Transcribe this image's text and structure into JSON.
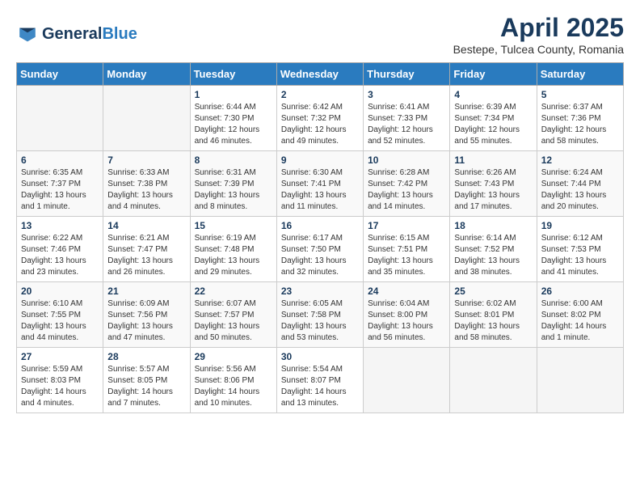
{
  "logo": {
    "general": "General",
    "blue": "Blue"
  },
  "title": "April 2025",
  "subtitle": "Bestepe, Tulcea County, Romania",
  "days_of_week": [
    "Sunday",
    "Monday",
    "Tuesday",
    "Wednesday",
    "Thursday",
    "Friday",
    "Saturday"
  ],
  "weeks": [
    [
      {
        "day": "",
        "info": ""
      },
      {
        "day": "",
        "info": ""
      },
      {
        "day": "1",
        "info": "Sunrise: 6:44 AM\nSunset: 7:30 PM\nDaylight: 12 hours and 46 minutes."
      },
      {
        "day": "2",
        "info": "Sunrise: 6:42 AM\nSunset: 7:32 PM\nDaylight: 12 hours and 49 minutes."
      },
      {
        "day": "3",
        "info": "Sunrise: 6:41 AM\nSunset: 7:33 PM\nDaylight: 12 hours and 52 minutes."
      },
      {
        "day": "4",
        "info": "Sunrise: 6:39 AM\nSunset: 7:34 PM\nDaylight: 12 hours and 55 minutes."
      },
      {
        "day": "5",
        "info": "Sunrise: 6:37 AM\nSunset: 7:36 PM\nDaylight: 12 hours and 58 minutes."
      }
    ],
    [
      {
        "day": "6",
        "info": "Sunrise: 6:35 AM\nSunset: 7:37 PM\nDaylight: 13 hours and 1 minute."
      },
      {
        "day": "7",
        "info": "Sunrise: 6:33 AM\nSunset: 7:38 PM\nDaylight: 13 hours and 4 minutes."
      },
      {
        "day": "8",
        "info": "Sunrise: 6:31 AM\nSunset: 7:39 PM\nDaylight: 13 hours and 8 minutes."
      },
      {
        "day": "9",
        "info": "Sunrise: 6:30 AM\nSunset: 7:41 PM\nDaylight: 13 hours and 11 minutes."
      },
      {
        "day": "10",
        "info": "Sunrise: 6:28 AM\nSunset: 7:42 PM\nDaylight: 13 hours and 14 minutes."
      },
      {
        "day": "11",
        "info": "Sunrise: 6:26 AM\nSunset: 7:43 PM\nDaylight: 13 hours and 17 minutes."
      },
      {
        "day": "12",
        "info": "Sunrise: 6:24 AM\nSunset: 7:44 PM\nDaylight: 13 hours and 20 minutes."
      }
    ],
    [
      {
        "day": "13",
        "info": "Sunrise: 6:22 AM\nSunset: 7:46 PM\nDaylight: 13 hours and 23 minutes."
      },
      {
        "day": "14",
        "info": "Sunrise: 6:21 AM\nSunset: 7:47 PM\nDaylight: 13 hours and 26 minutes."
      },
      {
        "day": "15",
        "info": "Sunrise: 6:19 AM\nSunset: 7:48 PM\nDaylight: 13 hours and 29 minutes."
      },
      {
        "day": "16",
        "info": "Sunrise: 6:17 AM\nSunset: 7:50 PM\nDaylight: 13 hours and 32 minutes."
      },
      {
        "day": "17",
        "info": "Sunrise: 6:15 AM\nSunset: 7:51 PM\nDaylight: 13 hours and 35 minutes."
      },
      {
        "day": "18",
        "info": "Sunrise: 6:14 AM\nSunset: 7:52 PM\nDaylight: 13 hours and 38 minutes."
      },
      {
        "day": "19",
        "info": "Sunrise: 6:12 AM\nSunset: 7:53 PM\nDaylight: 13 hours and 41 minutes."
      }
    ],
    [
      {
        "day": "20",
        "info": "Sunrise: 6:10 AM\nSunset: 7:55 PM\nDaylight: 13 hours and 44 minutes."
      },
      {
        "day": "21",
        "info": "Sunrise: 6:09 AM\nSunset: 7:56 PM\nDaylight: 13 hours and 47 minutes."
      },
      {
        "day": "22",
        "info": "Sunrise: 6:07 AM\nSunset: 7:57 PM\nDaylight: 13 hours and 50 minutes."
      },
      {
        "day": "23",
        "info": "Sunrise: 6:05 AM\nSunset: 7:58 PM\nDaylight: 13 hours and 53 minutes."
      },
      {
        "day": "24",
        "info": "Sunrise: 6:04 AM\nSunset: 8:00 PM\nDaylight: 13 hours and 56 minutes."
      },
      {
        "day": "25",
        "info": "Sunrise: 6:02 AM\nSunset: 8:01 PM\nDaylight: 13 hours and 58 minutes."
      },
      {
        "day": "26",
        "info": "Sunrise: 6:00 AM\nSunset: 8:02 PM\nDaylight: 14 hours and 1 minute."
      }
    ],
    [
      {
        "day": "27",
        "info": "Sunrise: 5:59 AM\nSunset: 8:03 PM\nDaylight: 14 hours and 4 minutes."
      },
      {
        "day": "28",
        "info": "Sunrise: 5:57 AM\nSunset: 8:05 PM\nDaylight: 14 hours and 7 minutes."
      },
      {
        "day": "29",
        "info": "Sunrise: 5:56 AM\nSunset: 8:06 PM\nDaylight: 14 hours and 10 minutes."
      },
      {
        "day": "30",
        "info": "Sunrise: 5:54 AM\nSunset: 8:07 PM\nDaylight: 14 hours and 13 minutes."
      },
      {
        "day": "",
        "info": ""
      },
      {
        "day": "",
        "info": ""
      },
      {
        "day": "",
        "info": ""
      }
    ]
  ]
}
